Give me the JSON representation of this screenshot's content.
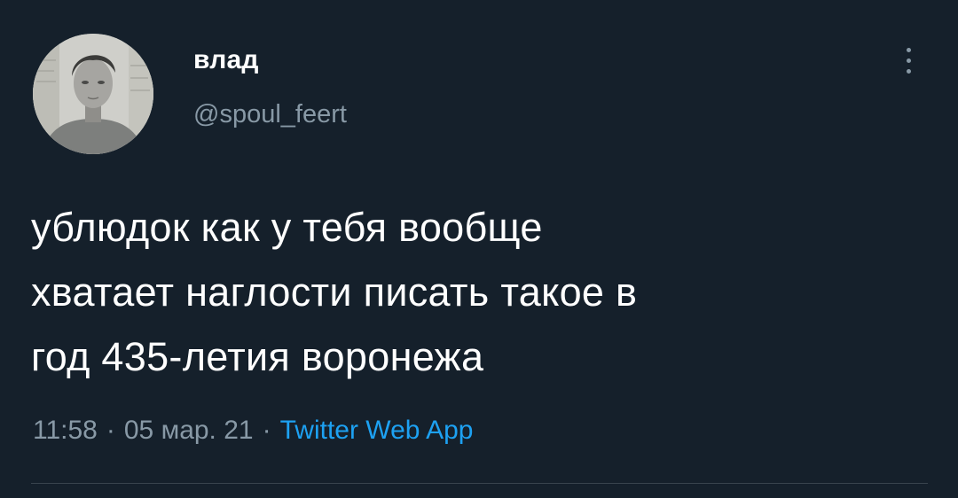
{
  "tweet": {
    "author": {
      "display_name": "влад",
      "handle": "@spoul_feert",
      "avatar": "profile-photo"
    },
    "text": "ублюдок как у тебя вообще\nхватает наглости писать такое в\nгод 435-летия воронежа",
    "meta": {
      "time": "11:58",
      "separator": "·",
      "date": "05 мар. 21",
      "source": "Twitter Web App"
    },
    "more_icon": "more-vertical-icon"
  },
  "colors": {
    "background": "#15202b",
    "text_primary": "#ffffff",
    "text_secondary": "#8899a6",
    "link": "#1da1f2",
    "divider": "#38444d"
  }
}
